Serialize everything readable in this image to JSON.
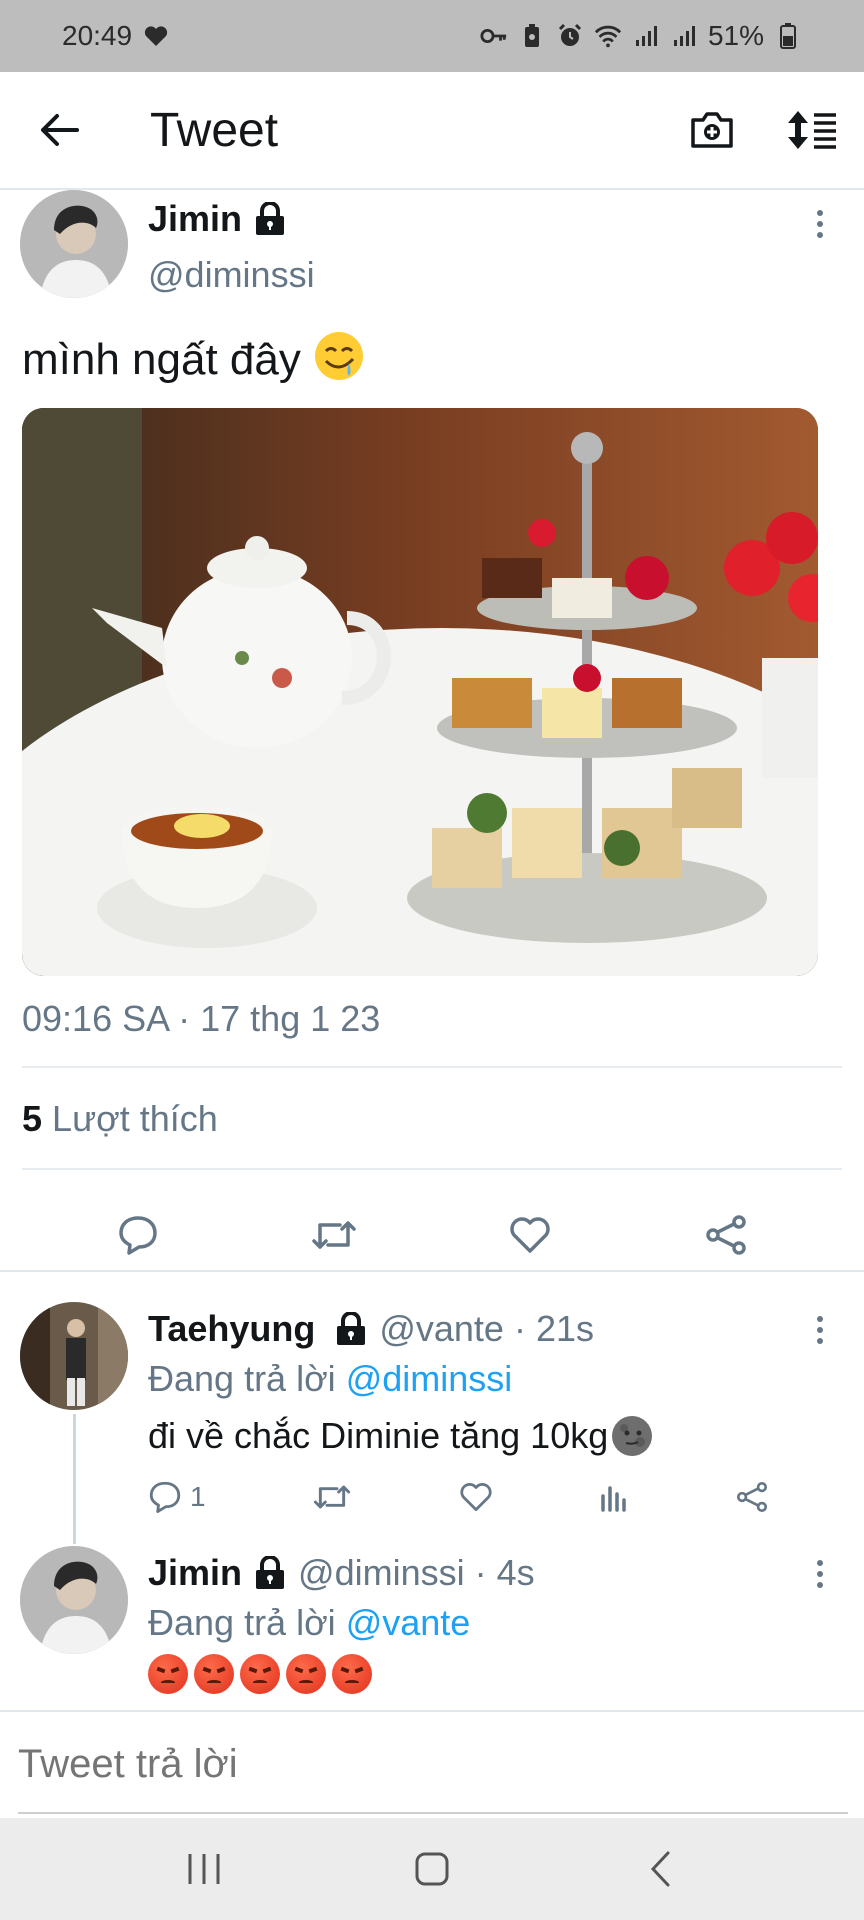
{
  "status_bar": {
    "time": "20:49",
    "battery": "51%",
    "icons": [
      "heart-icon",
      "key-icon",
      "battery-saver-icon",
      "alarm-icon",
      "wifi-icon",
      "signal-icon",
      "signal-icon",
      "battery-icon"
    ]
  },
  "header": {
    "title": "Tweet",
    "icons": [
      "back-arrow-icon",
      "camera-icon",
      "sort-icon"
    ]
  },
  "main_tweet": {
    "author_name": "Jimin",
    "author_handle": "@diminssi",
    "text": "mình ngất đây",
    "text_emoji": "drooling-face-emoji",
    "image": "afternoon-tea-photo",
    "timestamp": "09:16 SA · 17 thg 1 23",
    "likes_count": "5",
    "likes_label": "Lượt thích"
  },
  "replies": [
    {
      "author_name": "Taehyung",
      "author_handle": "@vante",
      "time": "· 21s",
      "replying_prefix": "Đang trả lời",
      "replying_to": "@diminssi",
      "text": "đi về chắc Diminie tăng 10kg",
      "text_emoji": "new-moon-face-emoji",
      "reply_count": "1"
    },
    {
      "author_name": "Jimin",
      "author_handle": "@diminssi",
      "time": "· 4s",
      "replying_prefix": "Đang trả lời",
      "replying_to": "@vante",
      "emojis": [
        "angry-face-emoji",
        "angry-face-emoji",
        "angry-face-emoji",
        "angry-face-emoji",
        "angry-face-emoji"
      ]
    }
  ],
  "composer": {
    "placeholder": "Tweet trả lời"
  },
  "colors": {
    "accent": "#1da1f2",
    "secondary_text": "#657786",
    "status_bar_bg": "#bdbdbd"
  }
}
